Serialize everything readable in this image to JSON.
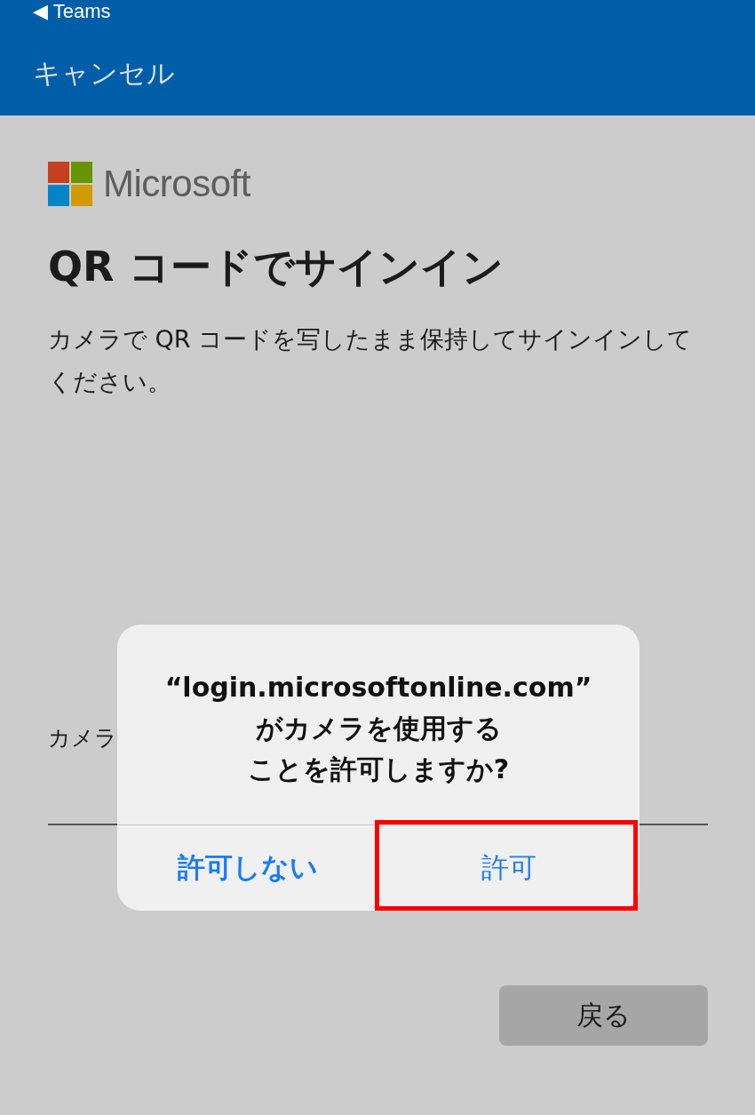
{
  "status_bar": {
    "back_label": "◀ Teams"
  },
  "header": {
    "cancel": "キャンセル"
  },
  "brand": {
    "name": "Microsoft"
  },
  "title": "QR コードでサインイン",
  "description": "カメラで QR コードを写したまま保持してサインインしてください。",
  "field": {
    "label": "カメラ"
  },
  "dialog": {
    "lines": [
      "“login.microsoftonline.com”",
      "がカメラを使用する",
      "ことを許可しますか?"
    ],
    "buttons": [
      {
        "label": "許可しない",
        "preferred": true,
        "highlighted": false
      },
      {
        "label": "許可",
        "preferred": false,
        "highlighted": true
      }
    ]
  },
  "back_button": "戻る"
}
